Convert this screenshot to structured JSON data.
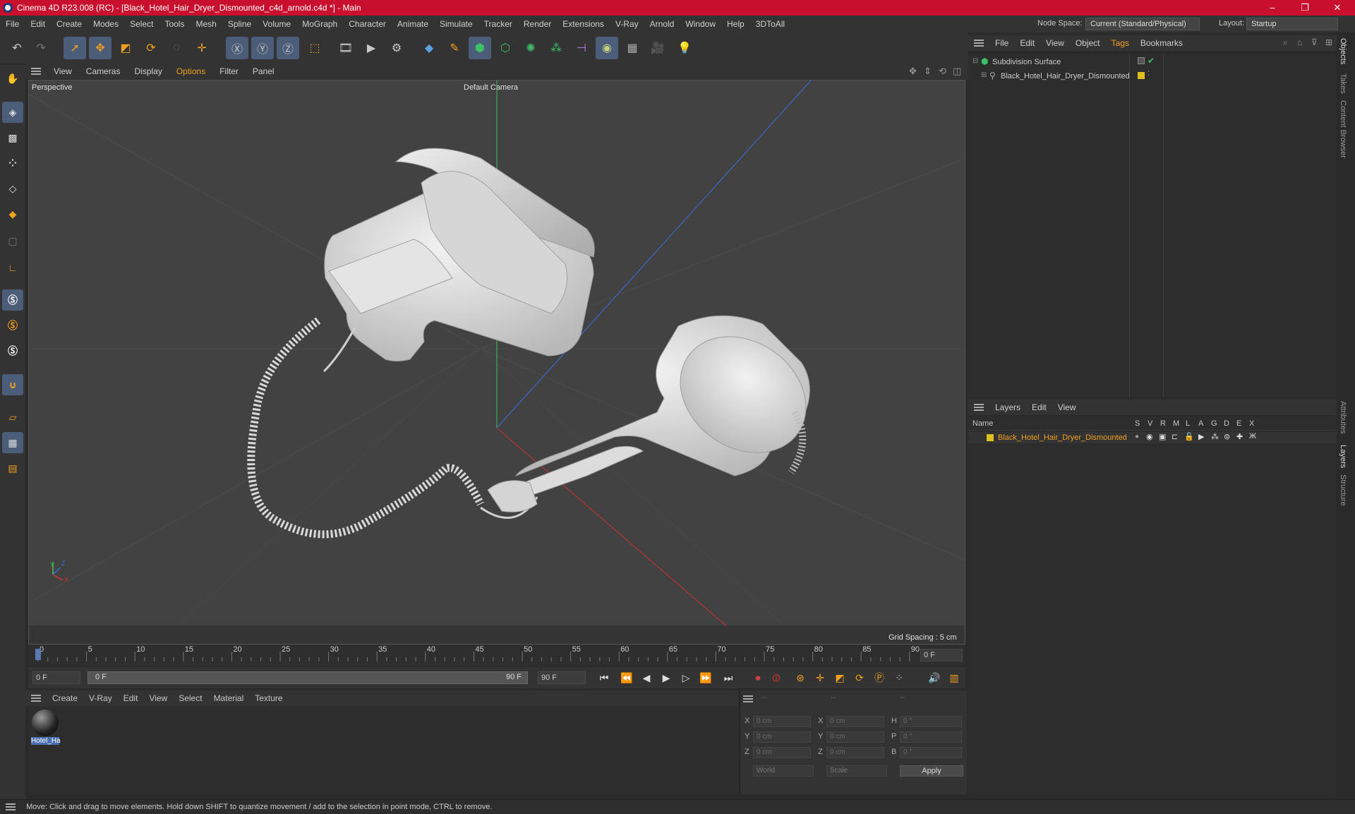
{
  "window": {
    "title": "Cinema 4D R23.008 (RC) - [Black_Hotel_Hair_Dryer_Dismounted_c4d_arnold.c4d *] - Main",
    "controls": [
      "–",
      "❐",
      "✕"
    ]
  },
  "menubar": {
    "items": [
      "File",
      "Edit",
      "Create",
      "Modes",
      "Select",
      "Tools",
      "Mesh",
      "Spline",
      "Volume",
      "MoGraph",
      "Character",
      "Animate",
      "Simulate",
      "Tracker",
      "Render",
      "Extensions",
      "V-Ray",
      "Arnold",
      "Window",
      "Help",
      "3DToAll"
    ],
    "node_space_label": "Node Space:",
    "node_space_value": "Current (Standard/Physical)",
    "layout_label": "Layout:",
    "layout_value": "Startup"
  },
  "viewport": {
    "menu": [
      "View",
      "Cameras",
      "Display",
      "Options",
      "Filter",
      "Panel"
    ],
    "name": "Perspective",
    "camera": "Default Camera",
    "grid_spacing": "Grid Spacing : 5 cm",
    "axis_labels": [
      "Y",
      "Z",
      "X"
    ]
  },
  "timeline": {
    "ticks": [
      "0",
      "5",
      "10",
      "15",
      "20",
      "25",
      "30",
      "35",
      "40",
      "45",
      "50",
      "55",
      "60",
      "65",
      "70",
      "75",
      "80",
      "85",
      "90"
    ],
    "current_frame": "0 F",
    "start": "0 F",
    "range_start": "0 F",
    "range_end": "90 F",
    "end": "90 F"
  },
  "materials": {
    "menu": [
      "Create",
      "V-Ray",
      "Edit",
      "View",
      "Select",
      "Material",
      "Texture"
    ],
    "items": [
      {
        "label": "Hotel_Ha"
      }
    ]
  },
  "coordinates": {
    "headers": [
      "--",
      "--",
      "--"
    ],
    "rows": [
      {
        "a": "X",
        "av": "0 cm",
        "b": "X",
        "bv": "0 cm",
        "c": "H",
        "cv": "0 °"
      },
      {
        "a": "Y",
        "av": "0 cm",
        "b": "Y",
        "bv": "0 cm",
        "c": "P",
        "cv": "0 °"
      },
      {
        "a": "Z",
        "av": "0 cm",
        "b": "Z",
        "bv": "0 cm",
        "c": "B",
        "cv": "0 °"
      }
    ],
    "mode": "World",
    "scale": "Scale",
    "apply": "Apply"
  },
  "objects": {
    "menu": [
      "File",
      "Edit",
      "View",
      "Object",
      "Tags",
      "Bookmarks"
    ],
    "tree": [
      {
        "name": "Subdivision Surface",
        "indent": 0
      },
      {
        "name": "Black_Hotel_Hair_Dryer_Dismounted",
        "indent": 1
      }
    ]
  },
  "layers": {
    "menu": [
      "Layers",
      "Edit",
      "View"
    ],
    "columns": [
      "Name",
      "S",
      "V",
      "R",
      "M",
      "L",
      "A",
      "G",
      "D",
      "E",
      "X"
    ],
    "rows": [
      {
        "name": "Black_Hotel_Hair_Dryer_Dismounted",
        "color": "#e0c020"
      }
    ]
  },
  "side_tabs": [
    "Objects",
    "Takes",
    "Content Browser",
    "Attributes",
    "Layers",
    "Structure"
  ],
  "status": "Move: Click and drag to move elements. Hold down SHIFT to quantize movement / add to the selection in point mode, CTRL to remove.",
  "colors": {
    "accent": "#f0a020",
    "title": "#c8102e",
    "selected": "#4b5d78"
  }
}
